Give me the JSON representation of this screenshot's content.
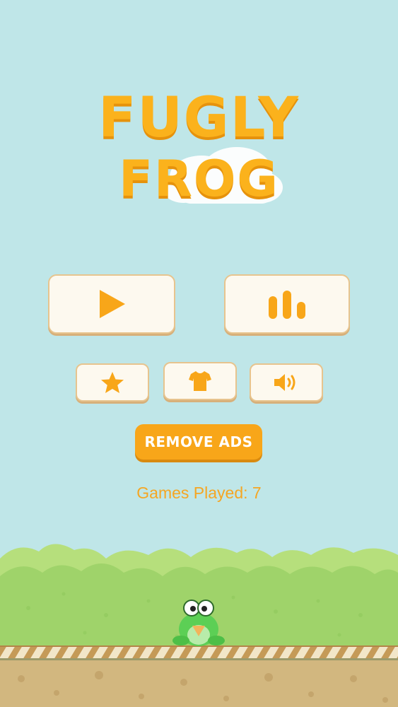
{
  "title": {
    "line1": "FUGLY",
    "line2": "FROG"
  },
  "menu": {
    "play_icon": "play-icon",
    "leaderboard_icon": "leaderboard-icon",
    "rate_icon": "star-icon",
    "skins_icon": "tshirt-icon",
    "sound_icon": "speaker-icon",
    "remove_ads_label": "REMOVE ADS"
  },
  "stats": {
    "games_played_label": "Games Played:",
    "games_played_value": "7"
  },
  "colors": {
    "sky": "#bfe6e8",
    "accent": "#fbb21c",
    "button_bg": "#fdf9ef",
    "bush": "#a9d86e",
    "ground": "#d2b77f"
  }
}
